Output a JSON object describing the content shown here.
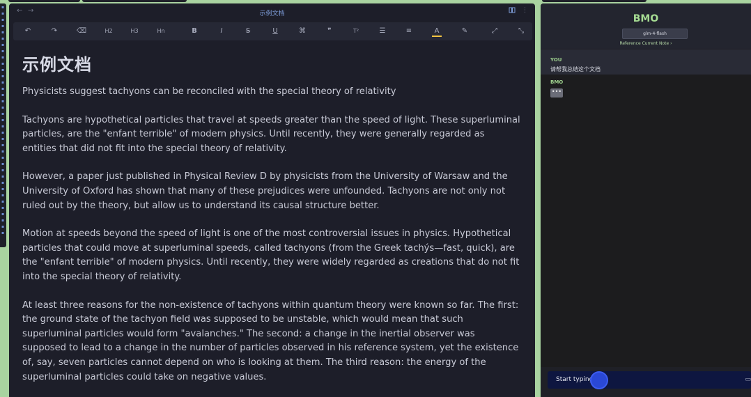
{
  "editor": {
    "doc_tab_title": "示例文档",
    "nav_back": "←",
    "nav_forward": "→",
    "header_right_icons": [
      "book-icon",
      "more-icon"
    ],
    "toolbar": [
      {
        "icon": "undo-icon",
        "glyph": "↶"
      },
      {
        "icon": "redo-icon",
        "glyph": "↷"
      },
      {
        "icon": "clear-format-icon",
        "glyph": "⌫"
      },
      {
        "icon": "heading-2-icon",
        "glyph": "H2"
      },
      {
        "icon": "heading-3-icon",
        "glyph": "H3"
      },
      {
        "icon": "heading-n-icon",
        "glyph": "Hn"
      },
      {
        "icon": "bold-icon",
        "glyph": "B"
      },
      {
        "icon": "italic-icon",
        "glyph": "I"
      },
      {
        "icon": "strikethrough-icon",
        "glyph": "S"
      },
      {
        "icon": "underline-icon",
        "glyph": "U"
      },
      {
        "icon": "link-icon",
        "glyph": "⌘"
      },
      {
        "icon": "quote-icon",
        "glyph": "❞"
      },
      {
        "icon": "superscript-icon",
        "glyph": "T²"
      },
      {
        "icon": "bullet-list-icon",
        "glyph": "☰"
      },
      {
        "icon": "align-icon",
        "glyph": "≡"
      },
      {
        "icon": "text-color-icon",
        "glyph": "A"
      },
      {
        "icon": "highlight-icon",
        "glyph": "✎"
      },
      {
        "icon": "expand-icon",
        "glyph": "⤢"
      },
      {
        "icon": "collapse-icon",
        "glyph": "⤡"
      }
    ],
    "heading": "示例文档",
    "subtitle": "Physicists suggest tachyons can be reconciled with the special theory of relativity",
    "paragraphs": [
      "Tachyons are hypothetical particles that travel at speeds greater than the speed of light. These superluminal particles, are the \"enfant terrible\" of modern physics. Until recently, they were generally regarded as entities that did not fit into the special theory of relativity.",
      "However, a paper just published in Physical Review D by physicists from the University of Warsaw and the University of Oxford has shown that many of these prejudices were unfounded. Tachyons are not only not ruled out by the theory, but allow us to understand its causal structure better.",
      "Motion at speeds beyond the speed of light is one of the most controversial issues in physics. Hypothetical particles that could move at superluminal speeds, called tachyons (from the Greek tachýs—fast, quick), are the \"enfant terrible\" of modern physics. Until recently, they were widely regarded as creations that do not fit into the special theory of relativity.",
      "At least three reasons for the non-existence of tachyons within quantum theory were known so far. The first: the ground state of the tachyon field was supposed to be unstable, which would mean that such superluminal particles would form \"avalanches.\" The second: a change in the inertial observer was supposed to lead to a change in the number of particles observed in his reference system, yet the existence of, say, seven particles cannot depend on who is looking at them. The third reason: the energy of the superluminal particles could take on negative values."
    ]
  },
  "chat": {
    "title": "BMO",
    "model": "glm-4-flash",
    "reference_note": "Reference Current Note ›",
    "user_label": "YOU",
    "user_message": "请帮我总结这个文档",
    "bot_label": "BMO",
    "typing_indicator": "•••",
    "input_placeholder": "Start typing...",
    "send_icon": "send-icon"
  },
  "colors": {
    "accent_green": "#a6dc93",
    "background": "#1d1e29",
    "frame": "#a9d3a0",
    "input_bar": "#0e1640",
    "cursor": "#2a48d6"
  }
}
